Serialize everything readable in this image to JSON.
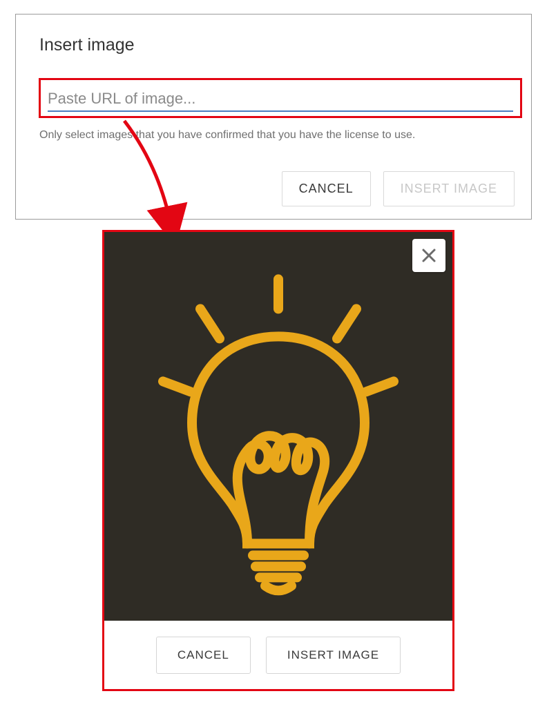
{
  "dialog1": {
    "title": "Insert image",
    "url_placeholder": "Paste URL of image...",
    "helper": "Only select images that you have confirmed that you have the license to use.",
    "cancel_label": "CANCEL",
    "insert_label": "INSERT IMAGE"
  },
  "dialog2": {
    "cancel_label": "CANCEL",
    "insert_label": "INSERT IMAGE",
    "image_description": "lightbulb-illustration"
  },
  "annotations": {
    "highlight_color": "#e30613",
    "arrow_color": "#e30613"
  }
}
